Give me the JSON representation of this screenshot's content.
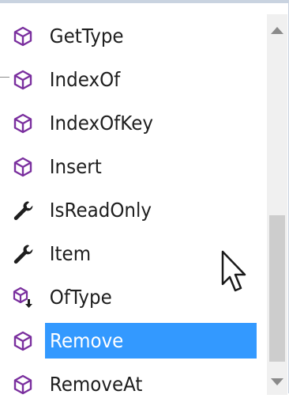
{
  "completion_list": {
    "items": [
      {
        "label": "GetType",
        "icon": "method-cube-icon",
        "selected": false
      },
      {
        "label": "IndexOf",
        "icon": "method-cube-icon",
        "selected": false
      },
      {
        "label": "IndexOfKey",
        "icon": "method-cube-icon",
        "selected": false
      },
      {
        "label": "Insert",
        "icon": "method-cube-icon",
        "selected": false
      },
      {
        "label": "IsReadOnly",
        "icon": "property-wrench-icon",
        "selected": false
      },
      {
        "label": "Item",
        "icon": "property-wrench-icon",
        "selected": false
      },
      {
        "label": "OfType",
        "icon": "extension-method-icon",
        "selected": false
      },
      {
        "label": "Remove",
        "icon": "method-cube-icon",
        "selected": true
      },
      {
        "label": "RemoveAt",
        "icon": "method-cube-icon",
        "selected": false
      }
    ]
  },
  "scrollbar": {
    "up_icon": "scroll-up-arrow-icon",
    "down_icon": "scroll-down-arrow-icon"
  },
  "colors": {
    "method_icon": "#7a2f9e",
    "selection": "#3399ff",
    "text": "#1e1e1e"
  }
}
